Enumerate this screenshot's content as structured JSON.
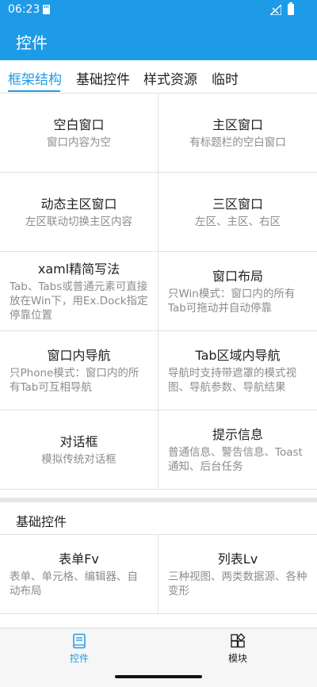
{
  "status": {
    "time": "06:23"
  },
  "app": {
    "title": "控件"
  },
  "tabs": [
    {
      "label": "框架结构",
      "active": true
    },
    {
      "label": "基础控件",
      "active": false
    },
    {
      "label": "样式资源",
      "active": false
    },
    {
      "label": "临时",
      "active": false
    }
  ],
  "framework_items": [
    {
      "title": "空白窗口",
      "desc": "窗口内容为空"
    },
    {
      "title": "主区窗口",
      "desc": "有标题栏的空白窗口"
    },
    {
      "title": "动态主区窗口",
      "desc": "左区联动切换主区内容"
    },
    {
      "title": "三区窗口",
      "desc": "左区、主区、右区"
    },
    {
      "title": "xaml精简写法",
      "desc": "Tab、Tabs或普通元素可直接放在Win下，用Ex.Dock指定停靠位置"
    },
    {
      "title": "窗口布局",
      "desc": "只Win模式：窗口内的所有Tab可拖动并自动停靠"
    },
    {
      "title": "窗口内导航",
      "desc": "只Phone模式：窗口内的所有Tab可互相导航"
    },
    {
      "title": "Tab区域内导航",
      "desc": "导航时支持带遮罩的模式视图、导航参数、导航结果"
    },
    {
      "title": "对话框",
      "desc": "模拟传统对话框"
    },
    {
      "title": "提示信息",
      "desc": "普通信息、警告信息、Toast通知、后台任务"
    }
  ],
  "section": {
    "title": "基础控件"
  },
  "basic_items": [
    {
      "title": "表单Fv",
      "desc": "表单、单元格、编辑器、自动布局"
    },
    {
      "title": "列表Lv",
      "desc": "三种视图、两类数据源、各种变形"
    }
  ],
  "bottom_nav": [
    {
      "label": "控件",
      "icon": "book-icon",
      "active": true
    },
    {
      "label": "模块",
      "icon": "modules-icon",
      "active": false
    }
  ],
  "colors": {
    "accent": "#1E9BE6",
    "text": "#222222",
    "subtext": "#8C8C8C"
  }
}
